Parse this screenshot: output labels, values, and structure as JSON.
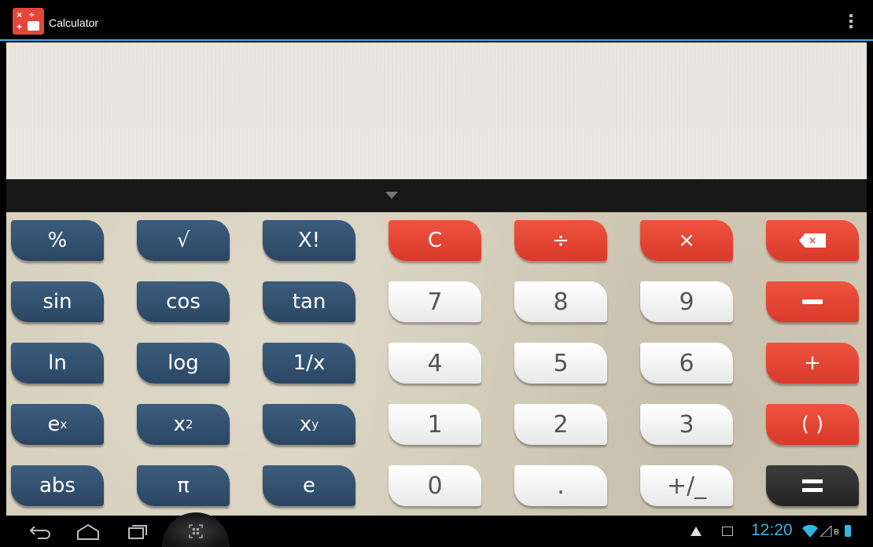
{
  "app": {
    "title": "Calculator"
  },
  "display": {
    "expression": ""
  },
  "keypad": {
    "rows": [
      [
        {
          "id": "percent",
          "label": "%",
          "style": "dark"
        },
        {
          "id": "sqrt",
          "label": "√",
          "style": "dark"
        },
        {
          "id": "factorial",
          "label": "X!",
          "style": "dark"
        },
        {
          "id": "clear",
          "label": "C",
          "style": "red"
        },
        {
          "id": "divide",
          "label": "÷",
          "style": "red"
        },
        {
          "id": "multiply",
          "label": "×",
          "style": "red"
        },
        {
          "id": "backspace",
          "label": "×",
          "style": "red",
          "icon": "backspace-icon"
        }
      ],
      [
        {
          "id": "sin",
          "label": "sin",
          "style": "dark"
        },
        {
          "id": "cos",
          "label": "cos",
          "style": "dark"
        },
        {
          "id": "tan",
          "label": "tan",
          "style": "dark"
        },
        {
          "id": "digit-7",
          "label": "7",
          "style": "light"
        },
        {
          "id": "digit-8",
          "label": "8",
          "style": "light"
        },
        {
          "id": "digit-9",
          "label": "9",
          "style": "light"
        },
        {
          "id": "subtract",
          "label": "",
          "style": "red",
          "icon": "minus-icon"
        }
      ],
      [
        {
          "id": "ln",
          "label": "ln",
          "style": "dark"
        },
        {
          "id": "log",
          "label": "log",
          "style": "dark"
        },
        {
          "id": "reciprocal",
          "label": "1/x",
          "style": "dark"
        },
        {
          "id": "digit-4",
          "label": "4",
          "style": "light"
        },
        {
          "id": "digit-5",
          "label": "5",
          "style": "light"
        },
        {
          "id": "digit-6",
          "label": "6",
          "style": "light"
        },
        {
          "id": "add",
          "label": "+",
          "style": "red"
        }
      ],
      [
        {
          "id": "exp",
          "label": "e",
          "sup": "x",
          "style": "dark"
        },
        {
          "id": "square",
          "label": "x",
          "sup": "2",
          "style": "dark"
        },
        {
          "id": "power",
          "label": "x",
          "sup": "y",
          "style": "dark"
        },
        {
          "id": "digit-1",
          "label": "1",
          "style": "light"
        },
        {
          "id": "digit-2",
          "label": "2",
          "style": "light"
        },
        {
          "id": "digit-3",
          "label": "3",
          "style": "light"
        },
        {
          "id": "parentheses",
          "label": "( )",
          "style": "red"
        }
      ],
      [
        {
          "id": "abs",
          "label": "abs",
          "style": "dark"
        },
        {
          "id": "pi",
          "label": "π",
          "style": "dark"
        },
        {
          "id": "euler",
          "label": "e",
          "style": "dark"
        },
        {
          "id": "digit-0",
          "label": "0",
          "style": "light"
        },
        {
          "id": "decimal",
          "label": ".",
          "style": "light"
        },
        {
          "id": "negate",
          "label": "+/_",
          "style": "light"
        },
        {
          "id": "equals",
          "label": "",
          "style": "black",
          "icon": "equals-icon"
        }
      ]
    ]
  },
  "status_bar": {
    "time": "12:20"
  },
  "colors": {
    "accent": "#33b5e5",
    "dark_key": "#2f4d6d",
    "red_key": "#e5473a",
    "light_key": "#f5f5f5"
  }
}
